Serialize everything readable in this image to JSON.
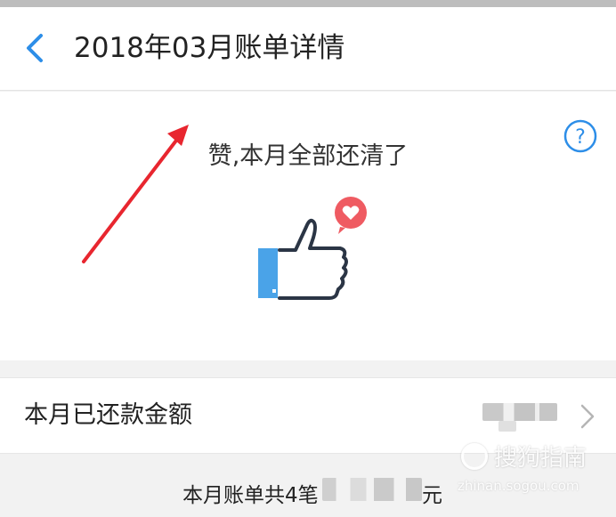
{
  "header": {
    "title": "2018年03月账单详情",
    "back_icon": "chevron-left-icon",
    "accent_color": "#2d8ee8"
  },
  "hero": {
    "status_text": "赞,本月全部还清了",
    "illustration": "thumbs-up-icon",
    "help_icon": "help-circle-icon"
  },
  "repaid_row": {
    "label": "本月已还款金额",
    "chevron_icon": "chevron-right-icon"
  },
  "footer": {
    "summary_prefix": "本月账单共4笔",
    "summary_suffix": "元"
  },
  "watermark": {
    "brand": "搜狗指南",
    "url": "zhinan.sogou.com"
  }
}
